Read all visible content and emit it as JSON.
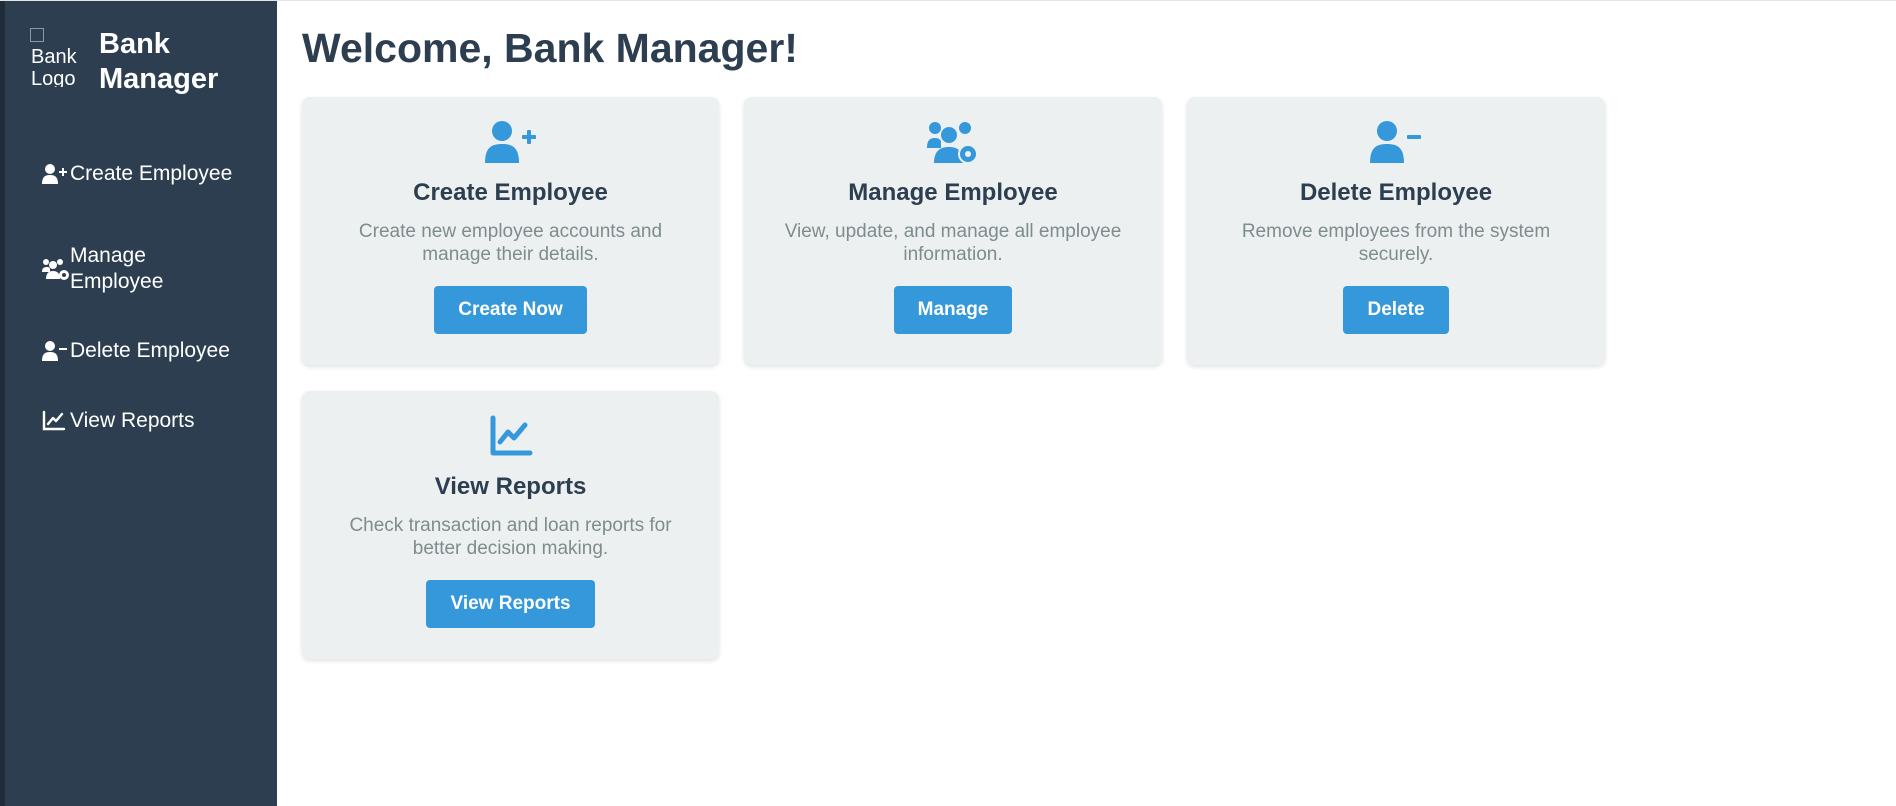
{
  "sidebar": {
    "logo_alt": "Bank Logo",
    "brand": "Bank Manager",
    "items": [
      {
        "label": "Create Employee",
        "icon": "user-plus-icon"
      },
      {
        "label": "Manage Employee",
        "icon": "users-cog-icon"
      },
      {
        "label": "Delete Employee",
        "icon": "user-minus-icon"
      },
      {
        "label": "View Reports",
        "icon": "chart-line-icon"
      }
    ]
  },
  "main": {
    "title": "Welcome, Bank Manager!",
    "cards": [
      {
        "title": "Create Employee",
        "description": "Create new employee accounts and manage their details.",
        "button": "Create Now",
        "icon": "user-plus-icon"
      },
      {
        "title": "Manage Employee",
        "description": "View, update, and manage all employee information.",
        "button": "Manage",
        "icon": "users-cog-icon"
      },
      {
        "title": "Delete Employee",
        "description": "Remove employees from the system securely.",
        "button": "Delete",
        "icon": "user-minus-icon"
      },
      {
        "title": "View Reports",
        "description": "Check transaction and loan reports for better decision making.",
        "button": "View Reports",
        "icon": "chart-line-icon"
      }
    ]
  },
  "colors": {
    "sidebar_bg": "#2c3e50",
    "accent": "#3498db",
    "card_bg": "#ecf0f1",
    "heading": "#2c3e50",
    "muted_text": "#7f8c8d"
  }
}
